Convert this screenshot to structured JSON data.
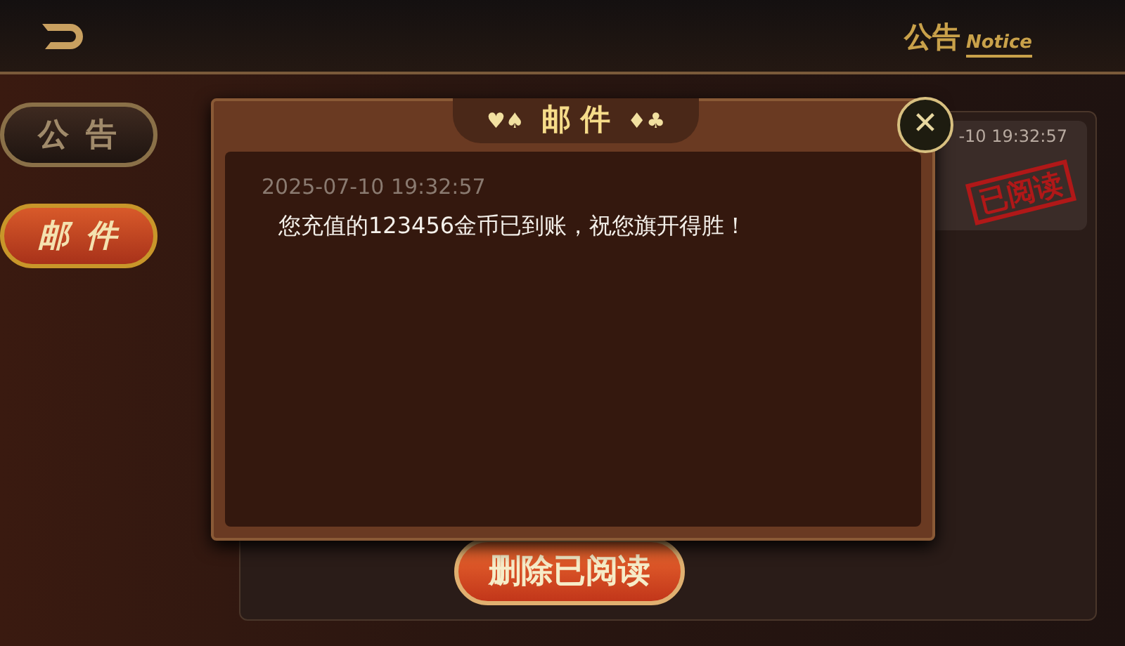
{
  "header": {
    "title": "公告",
    "subtitle": "Notice"
  },
  "sidebar": {
    "tabs": [
      {
        "label": "公 告",
        "selected": false
      },
      {
        "label": "邮 件",
        "selected": true
      }
    ]
  },
  "mail_list": {
    "items": [
      {
        "time": "-10 19:32:57",
        "stamp": "已阅读"
      }
    ]
  },
  "delete_button": "删除已阅读",
  "dialog": {
    "suits_left": "♥♠",
    "title": "邮 件",
    "suits_right": "♦♣",
    "close": "✕",
    "date": "2025-07-10 19:32:57",
    "message": "您充值的123456金币已到账，祝您旗开得胜！"
  }
}
